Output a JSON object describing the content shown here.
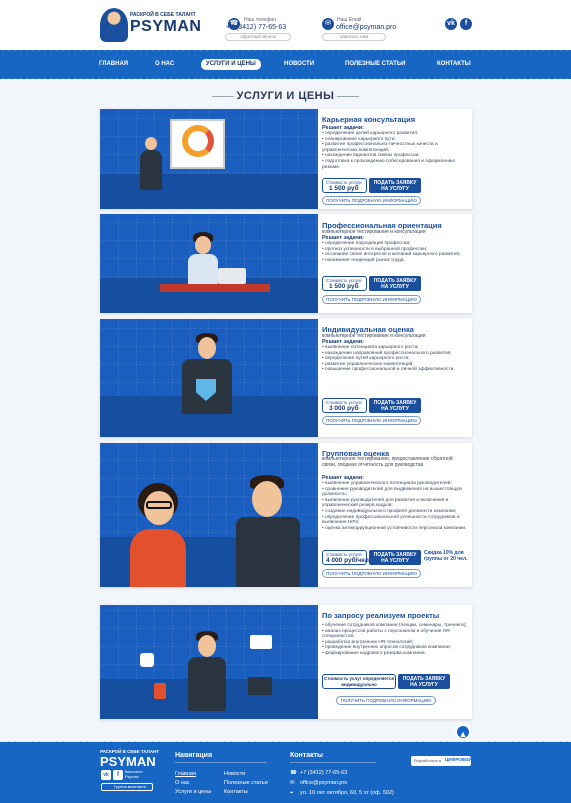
{
  "header": {
    "logo_tagline": "РАСКРОЙ В СЕБЕ ТАЛАНТ",
    "logo_name": "PSYMAN",
    "phone_label": "Наш телефон",
    "phone_value": "+7 (3412) 77-65-63",
    "callback_label": "обратный звонок",
    "email_label": "Наш Email",
    "email_value": "office@psyman.pro",
    "write_label": "написать нам",
    "social": {
      "vk": "vk",
      "fb": "f"
    }
  },
  "nav": {
    "items": [
      "ГЛАВНАЯ",
      "О НАС",
      "УСЛУГИ И ЦЕНЫ",
      "НОВОСТИ",
      "ПОЛЕЗНЫЕ СТАТЬИ",
      "КОНТАКТЫ"
    ],
    "active": "УСЛУГИ И ЦЕНЫ"
  },
  "page_title": "УСЛУГИ И ЦЕНЫ",
  "common": {
    "solves_label": "Решает задачи:",
    "price_label": "Стоимость услуги",
    "order_label_1": "ПОДАТЬ ЗАЯВКУ",
    "order_label_2": "НА УСЛУГУ",
    "more_label": "ПОЛУЧИТЬ ПОДРОБНУЮ ИНФОРМАЦИЮ"
  },
  "cards": [
    {
      "title": "Карьерная консультация",
      "subtitle": "",
      "items": [
        "определение целей карьерного развития;",
        "планирование карьерного пути;",
        "развитие профессионально-личностных качеств и управленческих компетенций;",
        "нахождение вариантов смены профессии;",
        "подготовка к прохождению собеседования и оформлению резюме."
      ],
      "price": "1 500 руб"
    },
    {
      "title": "Профессиональная ориентация",
      "subtitle": "компьютерное тестирование и консультация",
      "items": [
        "определение подходящей профессии;",
        "прогноз успешности в выбранной профессии;",
        "осознание своих интересов и желаний карьерного развития;",
        "понимание тенденций рынка труда."
      ],
      "price": "1 500 руб"
    },
    {
      "title": "Индивидуальная оценка",
      "subtitle": "компьютерное тестирование и консультация",
      "items": [
        "выявление потенциала карьерного роста;",
        "нахождение направлений профессионального развития;",
        "определение путей карьерного роста;",
        "развитие управленческих компетенций;",
        "повышение профессиональной и личной эффективности."
      ],
      "price": "3 000 руб"
    },
    {
      "title": "Групповая оценка",
      "subtitle": "компьютерное тестирование, предоставление обратной связи, сводная отчетность для руководства",
      "items": [
        "выявление управленческого потенциала руководителей;",
        "сравнение руководителей для выдвижения на вышестоящую должность;",
        "выявление руководителей для развития и включения в управленческий резерв кадров;",
        "создание индивидуального профиля должности компании;",
        "определение профессиональной успешности сотрудников и выявление HiPo;",
        "оценка антикоррупционной устойчивости персонала компании."
      ],
      "price": "4 000 руб/чел",
      "discount": "Скидка 10% для группы от 20 чел."
    },
    {
      "title": "По запросу реализуем проекты",
      "subtitle": "",
      "items": [
        "обучение сотрудников компании (лекции, семинары, тренинги);",
        "анализ процессов работы с персоналом и обучение HR-специалистов;",
        "разработка внутренних HR-технологий;",
        "проведение внутренних опросов сотрудников компании;",
        "формирование кадрового резерва компании."
      ],
      "price_note": "Стоимость услуг определяется индивидуально"
    }
  ],
  "footer": {
    "logo_tagline": "РАСКРОЙ В СЕБЕ ТАЛАНТ",
    "logo_name": "PSYMAN",
    "vk_label": "Вконтакте Psyman",
    "fb_label": "Группа вконтакте",
    "nav_heading": "Навигация",
    "nav_links": [
      "Главная",
      "Новости",
      "О нас",
      "Полезные статьи",
      "Услуги и цены",
      "Контакты"
    ],
    "contacts_heading": "Контакты",
    "phone": "+7 (3412) 77-65-63",
    "email": "office@psyman.pro",
    "address": "ул. 10 лет октября, 60, 5 эт (оф. 502)",
    "dev_label": "Разработано в",
    "dev_name": "ЦИФРОВОЙ"
  }
}
